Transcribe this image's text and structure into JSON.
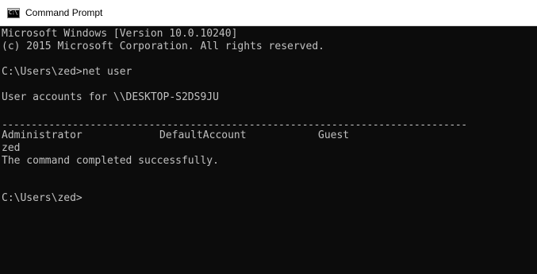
{
  "window": {
    "title": "Command Prompt",
    "icon": "cmd-icon",
    "icon_glyph": "C:\\"
  },
  "console": {
    "lines": [
      "Microsoft Windows [Version 10.0.10240]",
      "(c) 2015 Microsoft Corporation. All rights reserved.",
      "C:\\Users\\zed>net user",
      "User accounts for \\\\DESKTOP-S2DS9JU",
      "-------------------------------------------------------------------------------",
      "zed",
      "The command completed successfully.",
      "C:\\Users\\zed>"
    ],
    "accounts_columns": [
      "Administrator",
      "DefaultAccount",
      "Guest"
    ],
    "text_color": "#c0c0c0",
    "background_color": "#0c0c0c"
  }
}
